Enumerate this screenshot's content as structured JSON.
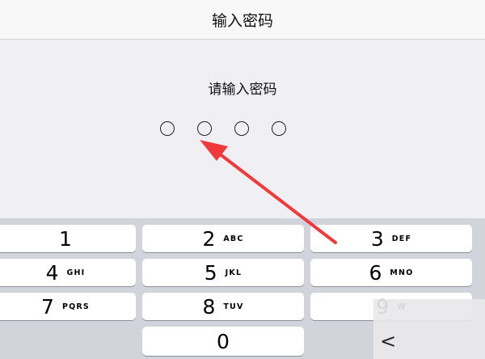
{
  "nav": {
    "title": "输入密码"
  },
  "prompt": "请输入密码",
  "pin": {
    "length": 4,
    "filled": 0
  },
  "keypad": {
    "keys": [
      {
        "num": "1",
        "letters": ""
      },
      {
        "num": "2",
        "letters": "ABC"
      },
      {
        "num": "3",
        "letters": "DEF"
      },
      {
        "num": "4",
        "letters": "GHI"
      },
      {
        "num": "5",
        "letters": "JKL"
      },
      {
        "num": "6",
        "letters": "MNO"
      },
      {
        "num": "7",
        "letters": "PQRS"
      },
      {
        "num": "8",
        "letters": "TUV"
      },
      {
        "num": "9",
        "letters": "W"
      },
      {
        "num": "0",
        "letters": ""
      }
    ],
    "delete_glyph": "<"
  },
  "colors": {
    "arrow": "#f0393a",
    "keypad_bg": "#d1d4db",
    "background": "#efeff4"
  }
}
